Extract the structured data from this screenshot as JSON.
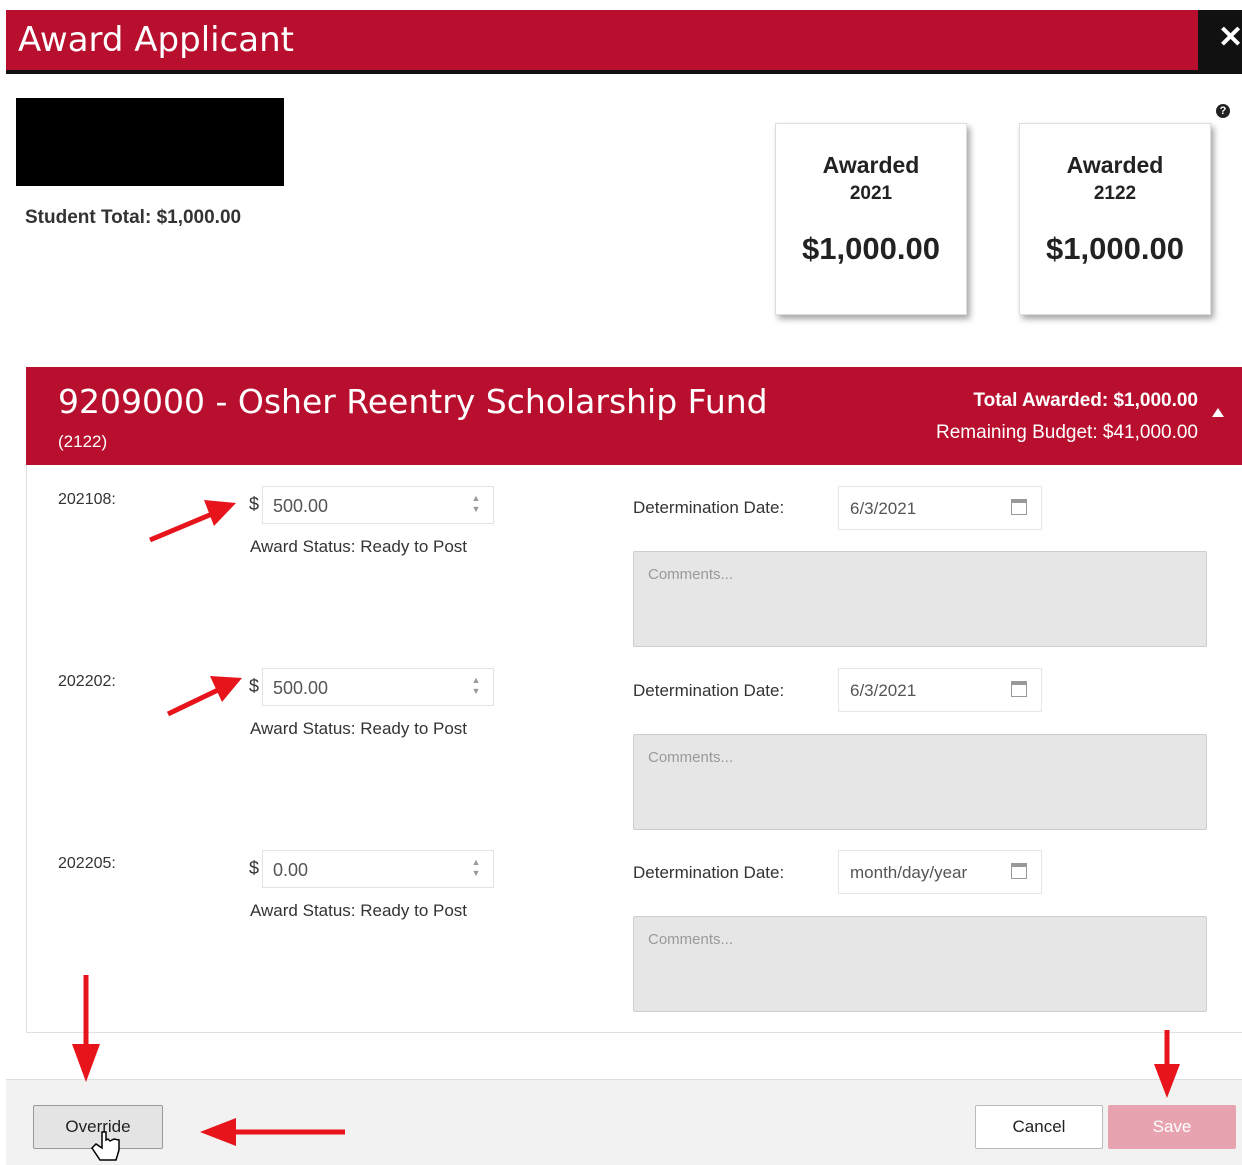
{
  "window": {
    "title": "Award Applicant",
    "close_glyph": "✕"
  },
  "student": {
    "total_label": "Student Total: $1,000.00"
  },
  "help": {
    "glyph": "?"
  },
  "cards": [
    {
      "heading": "Awarded",
      "year": "2021",
      "amount": "$1,000.00"
    },
    {
      "heading": "Awarded",
      "year": "2122",
      "amount": "$1,000.00"
    }
  ],
  "fund": {
    "title": "9209000 - Osher Reentry Scholarship Fund",
    "subtitle": "(2122)",
    "total_awarded": "Total Awarded: $1,000.00",
    "remaining_budget": "Remaining Budget: $41,000.00"
  },
  "rows": [
    {
      "term": "202108:",
      "currency": "$",
      "amount": "500.00",
      "status": "Award Status: Ready to Post",
      "det_label": "Determination Date:",
      "date": "6/3/2021",
      "comments_placeholder": "Comments..."
    },
    {
      "term": "202202:",
      "currency": "$",
      "amount": "500.00",
      "status": "Award Status: Ready to Post",
      "det_label": "Determination Date:",
      "date": "6/3/2021",
      "comments_placeholder": "Comments..."
    },
    {
      "term": "202205:",
      "currency": "$",
      "amount": "0.00",
      "status": "Award Status: Ready to Post",
      "det_label": "Determination Date:",
      "date": "month/day/year",
      "comments_placeholder": "Comments..."
    }
  ],
  "footer": {
    "override_label": "Override",
    "cancel_label": "Cancel",
    "save_label": "Save"
  },
  "colors": {
    "brand": "#b80f2e",
    "annotation_arrow": "#e8141c",
    "save_disabled": "#e8a3b0"
  }
}
